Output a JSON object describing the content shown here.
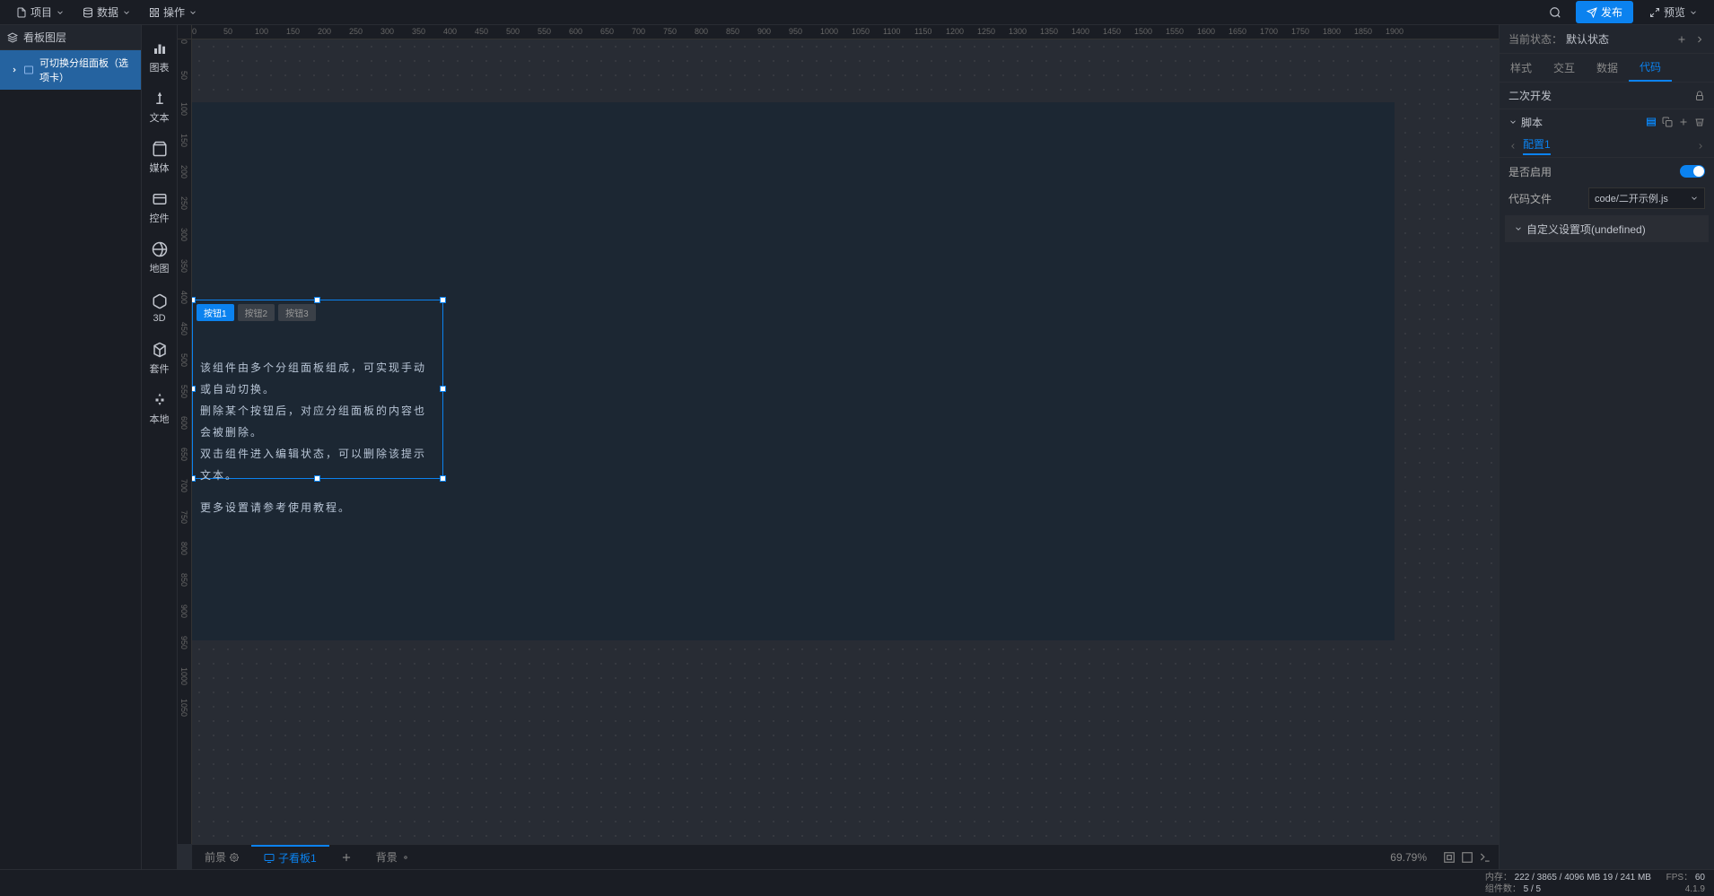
{
  "menu": {
    "project": "项目",
    "data": "数据",
    "operations": "操作",
    "publish": "发布",
    "preview": "预览"
  },
  "layers": {
    "title": "看板图层",
    "item1": "可切换分组面板（选项卡）"
  },
  "tools": {
    "chart": "图表",
    "text": "文本",
    "media": "媒体",
    "control": "控件",
    "map": "地图",
    "three_d": "3D",
    "suite": "套件",
    "local": "本地"
  },
  "canvas": {
    "tabs": {
      "t1": "按钮1",
      "t2": "按钮2",
      "t3": "按钮3"
    },
    "line1": "该组件由多个分组面板组成，可实现手动或自动切换。",
    "line2": "删除某个按钮后，对应分组面板的内容也会被删除。",
    "line3": "双击组件进入编辑状态，可以删除该提示文本。",
    "line4": "更多设置请参考使用教程。"
  },
  "bottom": {
    "foreground": "前景",
    "sub_board": "子看板1",
    "background": "背景",
    "zoom": "69.79%"
  },
  "right": {
    "state_label": "当前状态：",
    "state_value": "默认状态",
    "tabs": {
      "style": "样式",
      "interact": "交互",
      "data": "数据",
      "code": "代码"
    },
    "secondary_dev": "二次开发",
    "script": "脚本",
    "config": "配置1",
    "enable_label": "是否启用",
    "code_file_label": "代码文件",
    "code_file_value": "code/二开示例.js",
    "custom_section": "自定义设置项(undefined)"
  },
  "status": {
    "mem_label": "内存：",
    "mem_value": "222 / 3865 / 4096 MB  19 / 241 MB",
    "fps_label": "FPS：",
    "fps_value": "60",
    "comp_label": "组件数：",
    "comp_value": "5 / 5",
    "version": "4.1.9"
  },
  "ruler_h": [
    0,
    50,
    100,
    150,
    200,
    250,
    300,
    350,
    400,
    450,
    500,
    550,
    600,
    650,
    700,
    750,
    800,
    850,
    900,
    950,
    1000,
    1050,
    1100,
    1150,
    1200,
    1250,
    1300,
    1350,
    1400,
    1450,
    1500,
    1550,
    1600,
    1650,
    1700,
    1750,
    1800,
    1850,
    1900
  ],
  "ruler_v": [
    0,
    50,
    100,
    150,
    200,
    250,
    300,
    350,
    400,
    450,
    500,
    550,
    600,
    650,
    700,
    750,
    800,
    850,
    900,
    950,
    1000,
    1050
  ]
}
